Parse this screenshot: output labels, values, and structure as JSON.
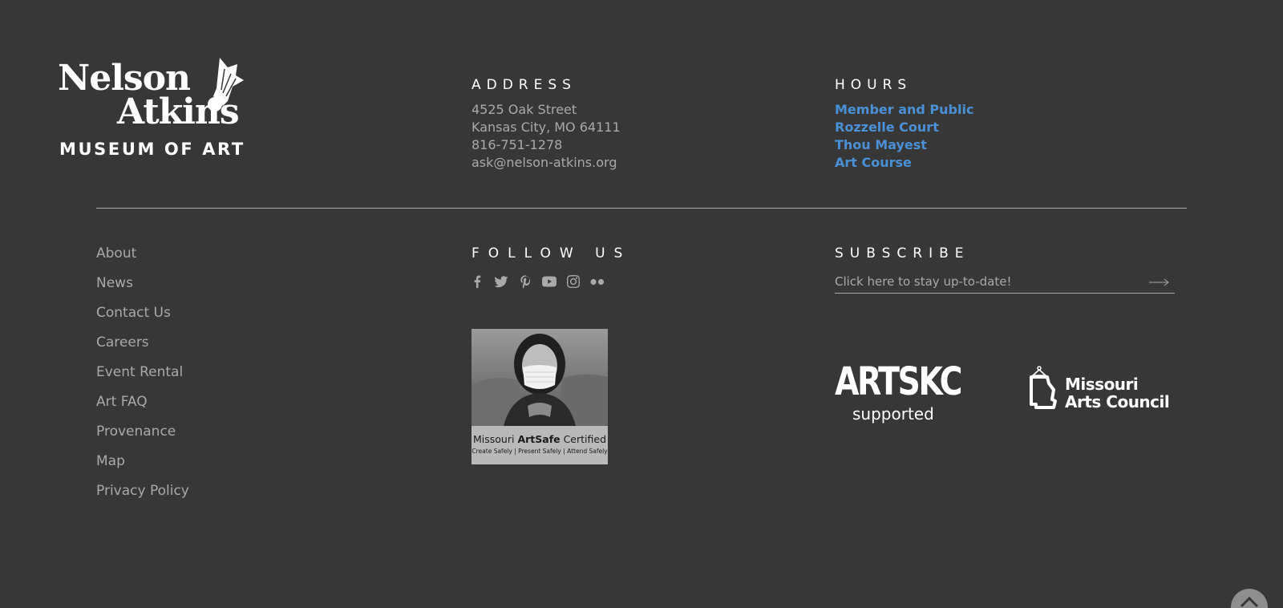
{
  "logo": {
    "line1": "Nelson",
    "line2": "Atkins",
    "line3": "MUSEUM OF ART"
  },
  "address": {
    "heading": "ADDRESS",
    "street": "4525 Oak Street",
    "city": "Kansas City, MO 64111",
    "phone": "816-751-1278",
    "email": "ask@nelson-atkins.org"
  },
  "hours": {
    "heading": "HOURS",
    "items": [
      "Member and Public",
      "Rozzelle Court",
      "Thou Mayest",
      "Art Course"
    ]
  },
  "nav": {
    "items": [
      "About",
      "News",
      "Contact Us",
      "Careers",
      "Event Rental",
      "Art FAQ",
      "Provenance",
      "Map",
      "Privacy Policy"
    ]
  },
  "follow": {
    "heading": "FOLLOW US",
    "icons": [
      "facebook-icon",
      "twitter-icon",
      "pinterest-icon",
      "youtube-icon",
      "instagram-icon",
      "flickr-icon"
    ]
  },
  "artsafe": {
    "title_pre": "Missouri ",
    "title_bold": "ArtSafe",
    "title_post": " Certified",
    "tagline": "Create Safely | Present Safely | Attend Safely"
  },
  "subscribe": {
    "heading": "SUBSCRIBE",
    "placeholder": "Click here to stay up-to-date!"
  },
  "sponsors": {
    "artskc_big": "ARTSKC",
    "artskc_small": "supported",
    "mac_line1": "Missouri",
    "mac_line2": "Arts Council"
  },
  "colors": {
    "background": "#373737",
    "text": "#a9a9a9",
    "link": "#4a90d6",
    "heading": "#ffffff"
  }
}
